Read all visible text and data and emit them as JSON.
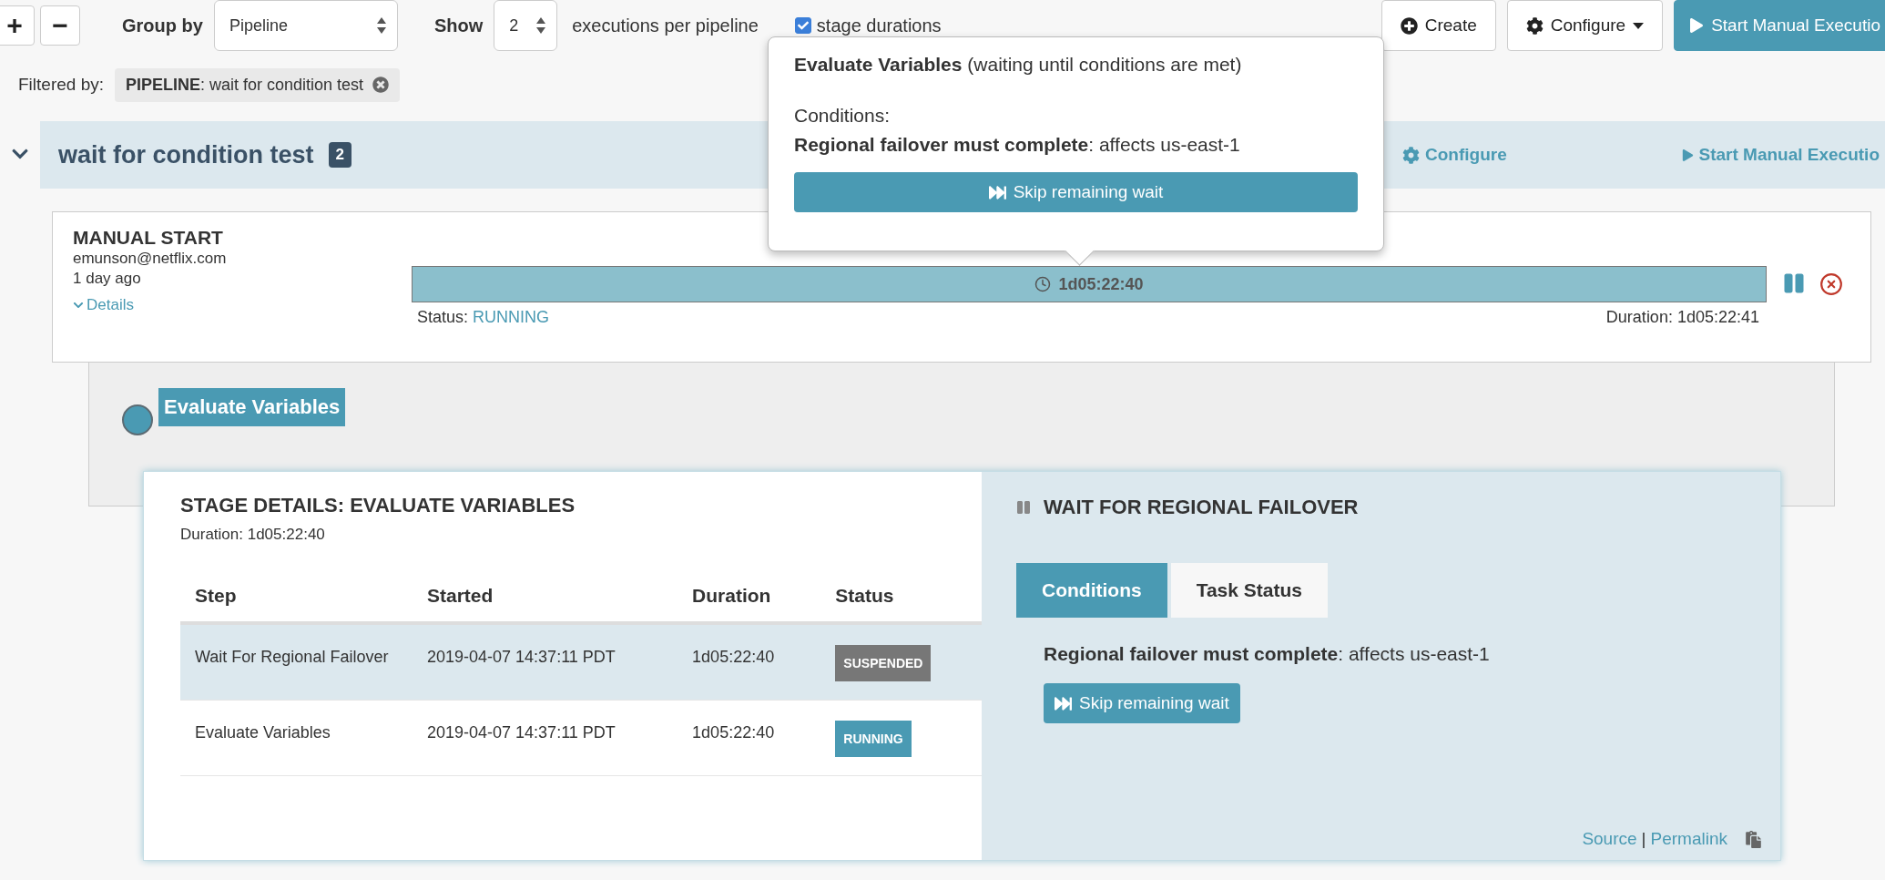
{
  "toolbar": {
    "expand_button": "+",
    "collapse_button": "−",
    "group_by": {
      "label": "Group by",
      "value": "Pipeline"
    },
    "show": {
      "label": "Show",
      "value": "2",
      "suffix": "executions per pipeline"
    },
    "stage_durations": {
      "label": "stage durations",
      "checked": true
    },
    "buttons": [
      {
        "kind": "create",
        "label": "Create"
      },
      {
        "kind": "configure",
        "label": "Configure"
      },
      {
        "kind": "start",
        "label": "Start Manual Executio"
      }
    ]
  },
  "filter": {
    "label": "Filtered by:",
    "tag": "**PIPELINE**: wait for condition test"
  },
  "pipeline": {
    "expanded": true,
    "name": "wait for condition test",
    "count": "2",
    "links": [
      {
        "kind": "configure",
        "label": "Configure"
      },
      {
        "kind": "start",
        "label": "Start Manual Executio"
      }
    ]
  },
  "execution": {
    "trigger": "MANUAL START",
    "user": "emunson@netflix.com",
    "age": "1 day ago",
    "details_link": "Details",
    "details_expanded": true,
    "level": 1,
    "bar_time": "1d05:22:40",
    "status_label": "Status:",
    "status": "RUNNING",
    "duration": "Duration: 1d05:22:41"
  },
  "stages": [
    {
      "label": "Evaluate Variables",
      "selected": true
    }
  ],
  "stage_details": {
    "title": "STAGE DETAILS: EVALUATE VARIABLES",
    "duration": "Duration: 1d05:22:40",
    "columns": [
      "Step",
      "Started",
      "Duration",
      "Status"
    ],
    "rows": [
      {
        "step": "Wait For Regional Failover",
        "started": "2019-04-07 14:37:11 PDT",
        "duration": "1d05:22:40",
        "status": "SUSPENDED",
        "color": "#777777",
        "selected": true
      },
      {
        "step": "Evaluate Variables",
        "started": "2019-04-07 14:37:11 PDT",
        "duration": "1d05:22:40",
        "status": "RUNNING",
        "color": "#4a9ab3",
        "selected": false
      }
    ]
  },
  "step_panel": {
    "title": "WAIT FOR REGIONAL FAILOVER",
    "tabs": [
      {
        "label": "Conditions",
        "selected": true
      },
      {
        "label": "Task Status",
        "selected": false
      }
    ],
    "condition": "**Regional failover must complete**: affects us-east-1",
    "skip_button": "Skip remaining wait",
    "links": [
      "Source",
      "Permalink"
    ],
    "separator": "|"
  },
  "popover": {
    "title": "**Evaluate Variables** (waiting until conditions are met)",
    "conditions_label": "Conditions:",
    "condition": "**Regional failover must complete**: affects us-east-1",
    "skip_button": "Skip remaining wait"
  }
}
